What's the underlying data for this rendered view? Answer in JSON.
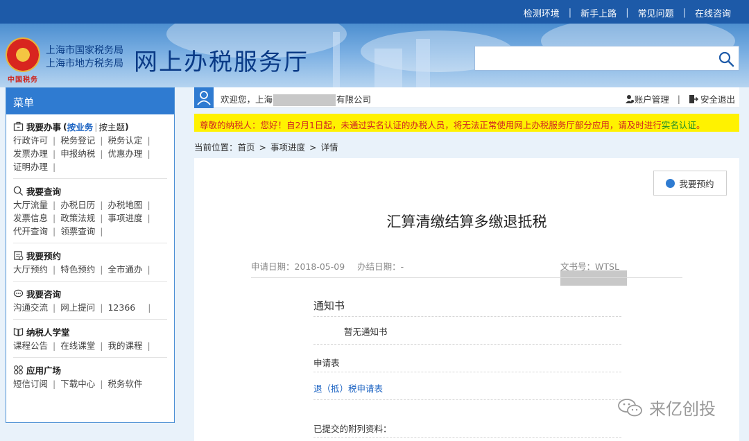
{
  "topbar": {
    "links": [
      "检测环境",
      "新手上路",
      "常见问题",
      "在线咨询"
    ],
    "separator": "|"
  },
  "header": {
    "bureau_line1": "上海市国家税务局",
    "bureau_line2": "上海市地方税务局",
    "site_name": "网上办税服务厅",
    "emblem_caption": "中国税务",
    "search": {
      "value": "",
      "placeholder": ""
    }
  },
  "sidebar": {
    "menu_label": "菜单",
    "sections": {
      "business": {
        "title": "我要办事",
        "open_paren": "(",
        "mode_business": "按业务",
        "mode_topic": "按主题",
        "close_paren": ")",
        "items": [
          "行政许可",
          "税务登记",
          "税务认定",
          "发票办理",
          "申报纳税",
          "优惠办理",
          "证明办理"
        ]
      },
      "query": {
        "title": "我要查询",
        "items": [
          "大厅流量",
          "办税日历",
          "办税地图",
          "发票信息",
          "政策法规",
          "事项进度",
          "代开查询",
          "领票查询"
        ]
      },
      "booking": {
        "title": "我要预约",
        "items": [
          "大厅预约",
          "特色预约",
          "全市通办"
        ]
      },
      "consult": {
        "title": "我要咨询",
        "items": [
          "沟通交流",
          "网上提问",
          "12366"
        ]
      },
      "school": {
        "title": "纳税人学堂",
        "items": [
          "课程公告",
          "在线课堂",
          "我的课程"
        ]
      },
      "apps": {
        "title": "应用广场",
        "items": [
          "短信订阅",
          "下载中心",
          "税务软件"
        ]
      }
    }
  },
  "welcome": {
    "prefix": "欢迎您，上海",
    "suffix": "有限公司",
    "account": "账户管理",
    "logout": "安全退出"
  },
  "notice": {
    "text": "尊敬的纳税人：您好！自2月1日起，未通过实名认证的办税人员，将无法正常使用网上办税服务厅部分应用，请及时进行",
    "link": "实名认证",
    "end": "。"
  },
  "breadcrumb": {
    "label": "当前位置：",
    "items": [
      "首页",
      "事项进度",
      "详情"
    ]
  },
  "detail": {
    "book_button": "我要预约",
    "title": "汇算清缴结算多缴退抵税",
    "apply_date_label": "申请日期：",
    "apply_date": "2018-05-09",
    "finish_date_label": "办结日期：",
    "finish_date": "-",
    "doc_no_label": "文书号：",
    "doc_no": "WTSL",
    "notice_section": "通知书",
    "no_notice": "暂无通知书",
    "application_section": "申请表",
    "application_link": "退（抵）税申请表",
    "attachments_section": "已提交的附列资料："
  },
  "watermark": {
    "text": "来亿创投"
  },
  "colors": {
    "brand_blue": "#1d5aa8",
    "menu_blue": "#2f7bd1",
    "notice_yellow": "#fff200",
    "notice_red": "#d02323",
    "link_green": "#1b8a2a"
  }
}
